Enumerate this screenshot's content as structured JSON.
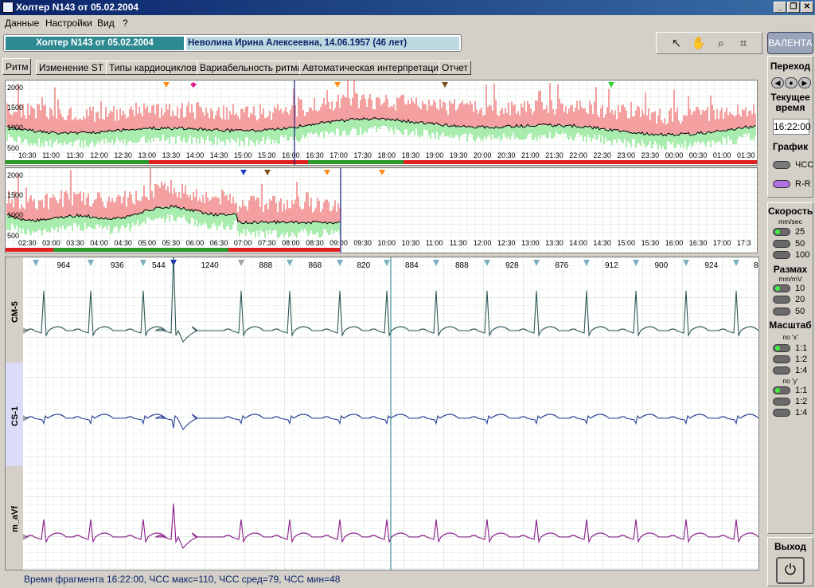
{
  "window": {
    "title": "Холтер  N143 от 05.02.2004",
    "min": "_",
    "max": "❐",
    "close": "✕"
  },
  "menu": [
    "Данные",
    "Настройки",
    "Вид",
    "?"
  ],
  "header": {
    "study": "Холтер  N143 от 05.02.2004",
    "patient": "Неволина Ирина Алексеевна,  14.06.1957  (46 лет)",
    "brand": "ВАЛЕНТА"
  },
  "tools": [
    {
      "icon": "pointer-icon",
      "glyph": "↖"
    },
    {
      "icon": "hand-icon",
      "glyph": "✋"
    },
    {
      "icon": "zoom-icon",
      "glyph": "⌕"
    },
    {
      "icon": "crop-icon",
      "glyph": "⌗"
    }
  ],
  "tabs": [
    "Ритм",
    "Изменение ST",
    "Типы кардиоциклов",
    "Вариабельность ритма",
    "Автоматическая интерпретация",
    "Отчет"
  ],
  "trend1": {
    "y_ticks": [
      "2000",
      "1500",
      "1000",
      "500"
    ],
    "x_ticks": [
      "10:30",
      "11:00",
      "11:30",
      "12:00",
      "12:30",
      "13:00",
      "13:30",
      "14:00",
      "14:30",
      "15:00",
      "15:30",
      "16:00",
      "16:30",
      "17:00",
      "17:30",
      "18:00",
      "18:30",
      "19:00",
      "19:30",
      "20:00",
      "20:30",
      "21:00",
      "21:30",
      "22:00",
      "22:30",
      "23:00",
      "23:30",
      "00:00",
      "00:30",
      "01:00",
      "01:30"
    ]
  },
  "trend2": {
    "y_ticks": [
      "2000",
      "1500",
      "1000",
      "500"
    ],
    "x_ticks": [
      "02:30",
      "03:00",
      "03:30",
      "04:00",
      "04:30",
      "05:00",
      "05:30",
      "06:00",
      "06:30",
      "07:00",
      "07:30",
      "08:00",
      "08:30",
      "09:00",
      "09:30",
      "10:00",
      "10:30",
      "11:00",
      "11:30",
      "12:00",
      "12:30",
      "13:00",
      "13:30",
      "14:00",
      "14:30",
      "15:00",
      "15:30",
      "16:00",
      "16:30",
      "17:00",
      "17:3"
    ]
  },
  "ecg": {
    "rr_intervals": [
      "964",
      "936",
      "544",
      "1240",
      "888",
      "868",
      "820",
      "884",
      "888",
      "928",
      "876",
      "912",
      "900",
      "924",
      "8"
    ],
    "leads": [
      "CM-5",
      "CS-1",
      "m_aVf"
    ],
    "lead_colors": {
      "CM-5": "#2f5858",
      "CS-1": "#2a3f9a",
      "m_aVf": "#8a1a8a"
    }
  },
  "status": "Время фрагмента 16:22:00,  ЧСС макс=110,  ЧСС сред=79,  ЧСС мин=48",
  "right": {
    "nav_title": "Переход",
    "time_title": "Текущее время",
    "time_value": "16:22:00",
    "graph_title": "График",
    "graph_options": [
      "ЧСС",
      "R-R"
    ],
    "speed_title": "Скорость",
    "speed_unit": "mm/sec",
    "speeds": [
      "25",
      "50",
      "100"
    ],
    "amp_title": "Размах",
    "amp_unit": "mm/mV",
    "amps": [
      "10",
      "20",
      "50"
    ],
    "scale_title": "Масштаб",
    "scale_x": "по 'x'",
    "scale_y": "по 'y'",
    "scales_x": [
      "1:1",
      "1:2",
      "1:4"
    ],
    "scales_y": [
      "1:1",
      "1:2",
      "1:4"
    ],
    "exit_title": "Выход"
  }
}
